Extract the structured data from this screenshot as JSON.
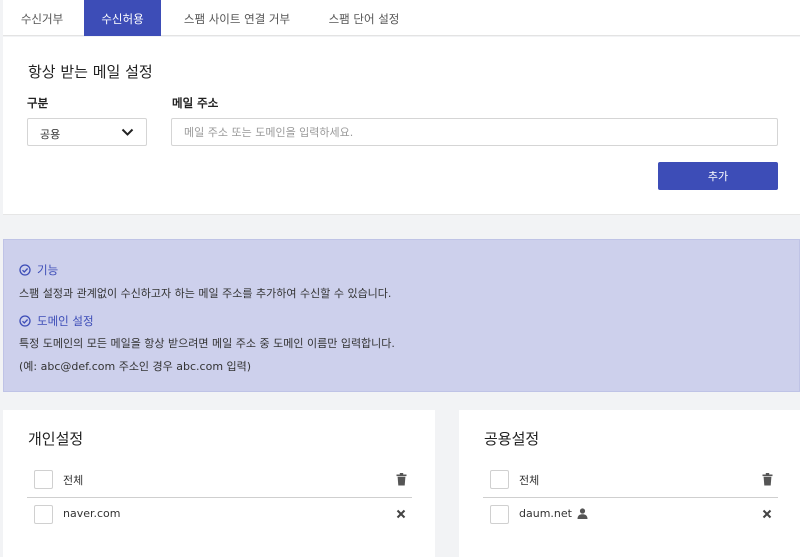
{
  "tabs": [
    {
      "label": "수신거부",
      "active": false
    },
    {
      "label": "수신허용",
      "active": true
    },
    {
      "label": "스팸 사이트 연결 거부",
      "active": false
    },
    {
      "label": "스팸 단어 설정",
      "active": false
    }
  ],
  "settings": {
    "title": "항상 받는 메일 설정",
    "category_label": "구분",
    "category_value": "공용",
    "email_label": "메일 주소",
    "email_placeholder": "메일 주소 또는 도메인을 입력하세요.",
    "add_button": "추가"
  },
  "info": {
    "feature_title": "기능",
    "feature_text": "스팸 설정과 관계없이 수신하고자 하는 메일 주소를 추가하여 수신할 수 있습니다.",
    "domain_title": "도메인 설정",
    "domain_text": "특정 도메인의 모든 메일을 항상 받으려면 메일 주소 중 도메인 이름만 입력합니다.",
    "domain_example": "(예: abc@def.com 주소인 경우 abc.com 입력)"
  },
  "personal": {
    "title": "개인설정",
    "all_label": "전체",
    "items": [
      {
        "address": "naver.com"
      }
    ]
  },
  "shared": {
    "title": "공용설정",
    "all_label": "전체",
    "items": [
      {
        "address": "daum.net"
      }
    ]
  },
  "colors": {
    "accent": "#3d4db7",
    "info_bg": "#cdd0ec"
  }
}
